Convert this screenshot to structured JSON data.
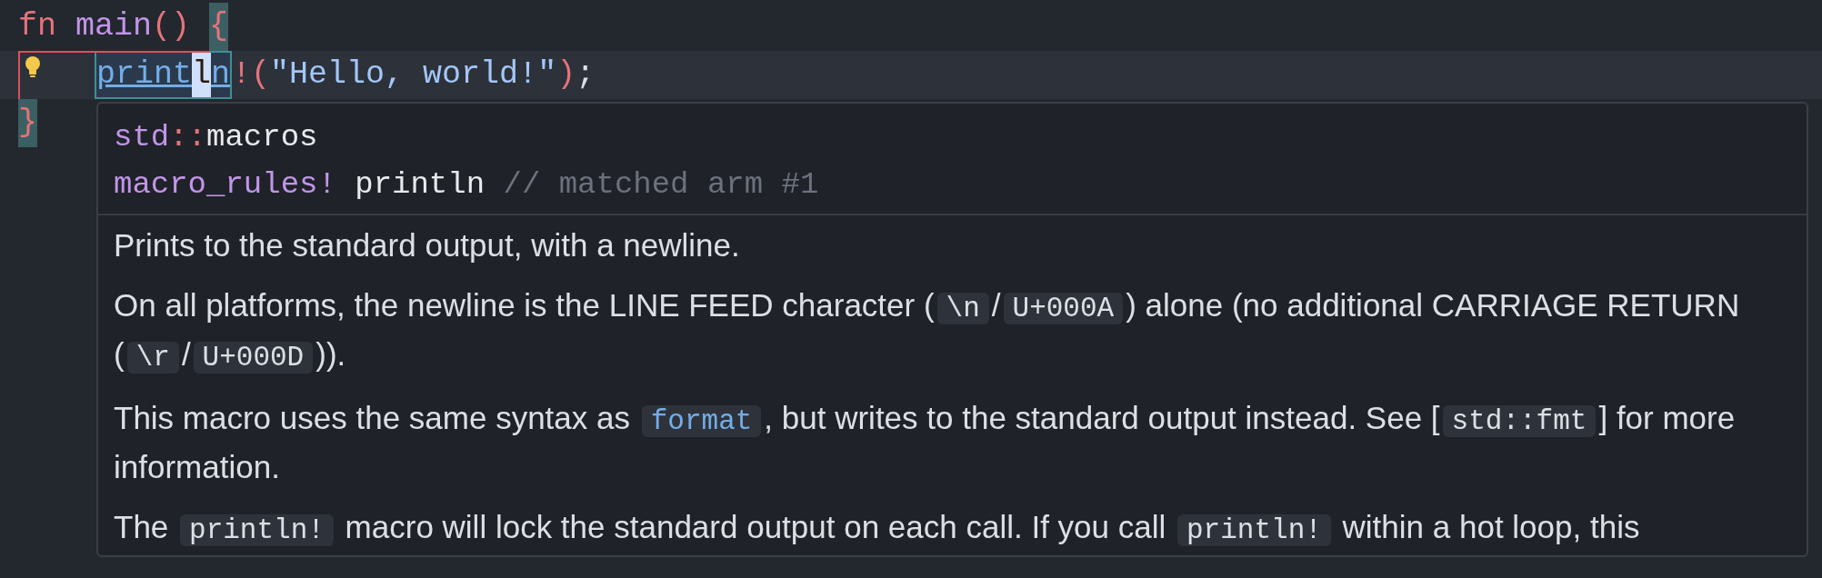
{
  "editor": {
    "lines": [
      {
        "current": false,
        "diagnostic": false,
        "code_action": false,
        "indented": false,
        "tokens": [
          {
            "text": "fn ",
            "kind": "keyword"
          },
          {
            "text": "main",
            "kind": "function"
          },
          {
            "text": "() ",
            "kind": "punctuation"
          },
          {
            "text": "{",
            "kind": "bracket_match"
          }
        ]
      },
      {
        "current": true,
        "diagnostic": true,
        "code_action": true,
        "indented": true,
        "tokens": [
          {
            "text": "print",
            "kind": "hovered_macro",
            "cursor": false
          },
          {
            "text": "l",
            "kind": "hovered_macro",
            "cursor": true
          },
          {
            "text": "n",
            "kind": "hovered_macro",
            "cursor": false
          },
          {
            "text": "!(",
            "kind": "punctuation"
          },
          {
            "text": "\"Hello, world!\"",
            "kind": "string"
          },
          {
            "text": ")",
            "kind": "punctuation"
          },
          {
            "text": ";",
            "kind": "plain"
          }
        ]
      },
      {
        "current": false,
        "diagnostic": false,
        "code_action": false,
        "indented": false,
        "tokens": [
          {
            "text": "}",
            "kind": "bracket_match"
          }
        ]
      }
    ]
  },
  "hover": {
    "header": [
      [
        {
          "text": "std",
          "kind": "path"
        },
        {
          "text": "::",
          "kind": "operator"
        },
        {
          "text": "macros",
          "kind": "plain"
        }
      ],
      [
        {
          "text": "macro_rules!",
          "kind": "path"
        },
        {
          "text": " println ",
          "kind": "plain"
        },
        {
          "text": "// matched arm #1",
          "kind": "comment"
        }
      ]
    ],
    "paragraphs": [
      [
        {
          "text": "Prints to the standard output, with a newline.",
          "kind": "text"
        }
      ],
      [
        {
          "text": "On all platforms, the newline is the LINE FEED character (",
          "kind": "text"
        },
        {
          "text": "\\n",
          "kind": "code"
        },
        {
          "text": "/",
          "kind": "text"
        },
        {
          "text": "U+000A",
          "kind": "code"
        },
        {
          "text": ") alone (no additional CARRIAGE RETURN (",
          "kind": "text"
        },
        {
          "text": "\\r",
          "kind": "code"
        },
        {
          "text": "/",
          "kind": "text"
        },
        {
          "text": "U+000D",
          "kind": "code"
        },
        {
          "text": ")).",
          "kind": "text"
        }
      ],
      [
        {
          "text": "This macro uses the same syntax as ",
          "kind": "text"
        },
        {
          "text": "format",
          "kind": "link"
        },
        {
          "text": ", but writes to the standard output instead. See [",
          "kind": "text"
        },
        {
          "text": "std::fmt",
          "kind": "code"
        },
        {
          "text": "] for more information.",
          "kind": "text"
        }
      ],
      [
        {
          "text": "The ",
          "kind": "text"
        },
        {
          "text": "println!",
          "kind": "code"
        },
        {
          "text": " macro will lock the standard output on each call. If you call ",
          "kind": "text"
        },
        {
          "text": "println!",
          "kind": "code"
        },
        {
          "text": " within a hot loop, this",
          "kind": "text"
        }
      ]
    ]
  }
}
